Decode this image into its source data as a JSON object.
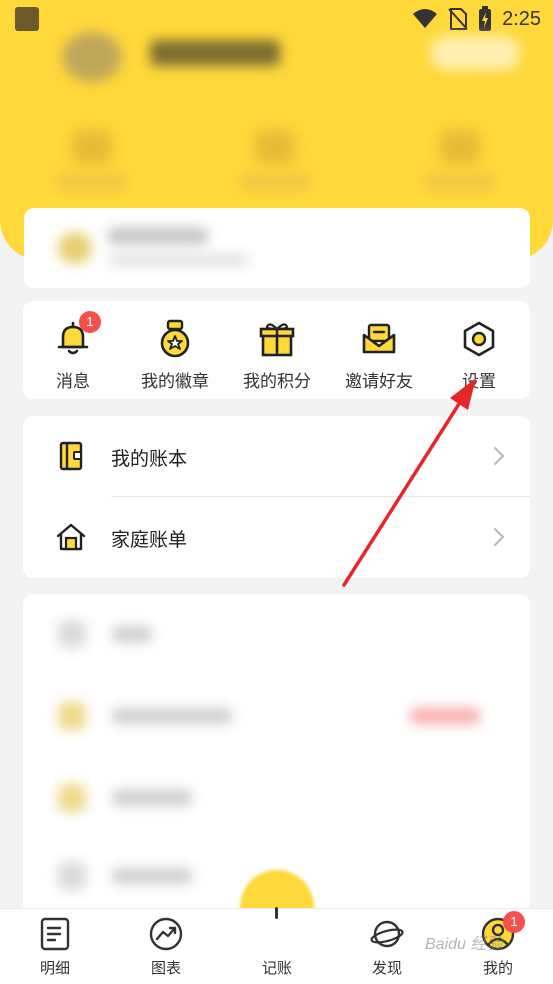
{
  "status_bar": {
    "time": "2:25"
  },
  "quick_actions": [
    {
      "label": "消息",
      "icon": "bell-icon",
      "badge": "1"
    },
    {
      "label": "我的徽章",
      "icon": "medal-icon"
    },
    {
      "label": "我的积分",
      "icon": "gift-icon"
    },
    {
      "label": "邀请好友",
      "icon": "envelope-icon"
    },
    {
      "label": "设置",
      "icon": "gear-icon"
    }
  ],
  "account_books": [
    {
      "label": "我的账本",
      "icon": "book-icon"
    },
    {
      "label": "家庭账单",
      "icon": "house-icon"
    }
  ],
  "bottom_nav": [
    {
      "label": "明细",
      "icon": "list-icon"
    },
    {
      "label": "图表",
      "icon": "chart-icon"
    },
    {
      "label": "记账",
      "icon": "add-record-icon"
    },
    {
      "label": "发现",
      "icon": "planet-icon"
    },
    {
      "label": "我的",
      "icon": "profile-icon",
      "badge": "1",
      "active": true
    }
  ],
  "watermark": "Baidu 经验",
  "colors": {
    "accent": "#ffd83a",
    "badge": "#f4504c",
    "annotation_arrow": "#e8262a"
  }
}
